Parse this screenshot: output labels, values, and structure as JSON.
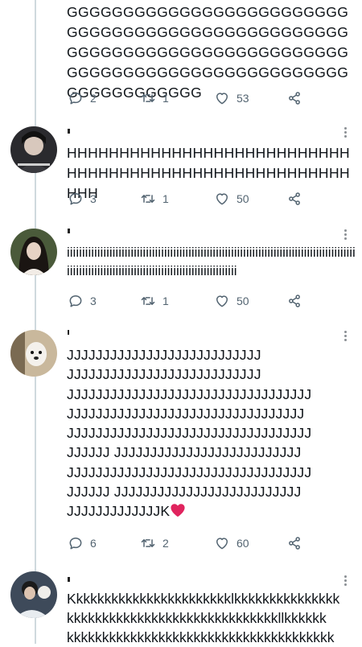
{
  "tweets": [
    {
      "text": "GGGGGGGGGGGGGGGGGGGGGGGGGGGGGGGGGGGGGGGGGGGGGGGGGGGGGGGGGGGGGGGGGGGGGGGGGGGGGGGGGGGGGGGGGGGGGGGGGGGGGGGGGGGGGGGG",
      "replies": "2",
      "retweets": "1",
      "likes": "53"
    },
    {
      "text": "HHHHHHHHHHHHHHHHHHHHHHHHHHHHHHHHHHHHHHHHHHHHHHHHHHHHHHHHH",
      "replies": "3",
      "retweets": "1",
      "likes": "50"
    },
    {
      "text": "iiiiiiiiiiiiiiiiiiiiiiiiiiiiiiiiiiiiiiiiiiiiiiiiiiiiiiiiiiiiiiiiiiiiiiiiiiiiiiiiiiiiiiiiiiiiiiiiiiiiiiiiiiiiiiiiiiiiiiiiiiiiiiiiiiiiiiiiiiiiiiiiiiiiiii",
      "replies": "3",
      "retweets": "1",
      "likes": "50"
    },
    {
      "text": "JJJJJJJJJJJJJJJJJJJJJJJJJJJ\nJJJJJJJJJJJJJJJJJJJJJJJJJJJ\nJJJJJJJJJJJJJJJJJJJJJJJJJJJJJJJJJJ\nJJJJJJJJJJJJJJJJJJJJJJJJJJJJJJJJJ\nJJJJJJJJJJJJJJJJJJJJJJJJJJJJJJJJJJ\nJJJJJJ JJJJJJJJJJJJJJJJJJJJJJJJJJ\nJJJJJJJJJJJJJJJJJJJJJJJJJJJJJJJJJJ\nJJJJJJ JJJJJJJJJJJJJJJJJJJJJJJJJJ\nJJJJJJJJJJJJJK",
      "emoji": "❤",
      "replies": "6",
      "retweets": "2",
      "likes": "60"
    },
    {
      "text": "Kkkkkkkkkkkkkkkkkkkkkkklkkkkkkkkkkkkkkk\nkkkkkkkkkkkkkkkkkkkkkkkkkkkkkkllkkkkkk\nkkkkkkkkkkkkkkkkkkkkkkkkkkkkkkkkkkkkkk",
      "replies": "",
      "retweets": "",
      "likes": ""
    }
  ],
  "icons": {
    "reply": "reply-icon",
    "retweet": "retweet-icon",
    "like": "heart-icon",
    "share": "share-icon",
    "more": "more-icon"
  },
  "colors": {
    "thread_line": "#cfd9de",
    "action_gray": "#536471",
    "heart_red": "#e0245e"
  }
}
